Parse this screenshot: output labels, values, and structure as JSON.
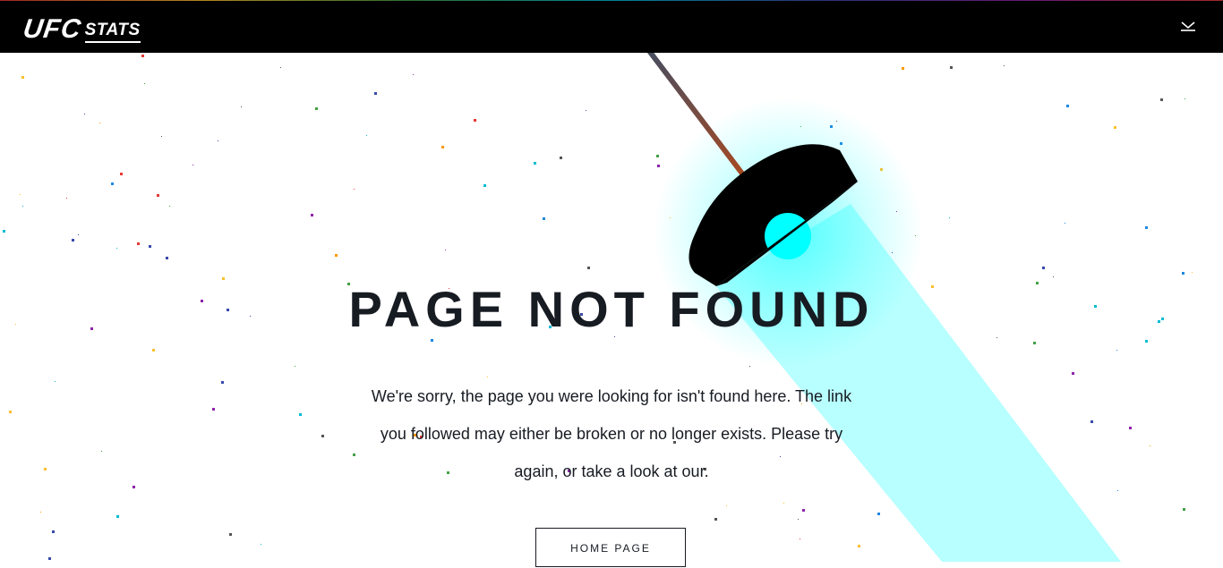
{
  "header": {
    "logo_main": "UFC",
    "logo_sub": "STATS",
    "menu_icon": "chevron-down-icon"
  },
  "error": {
    "title": "PAGE NOT FOUND",
    "message": "We're sorry, the page you were looking for isn't found here. The link you followed may either be broken or no longer exists. Please try again, or take a look at our.",
    "home_button": "HOME PAGE"
  },
  "colors": {
    "header_bg": "#000000",
    "page_bg": "#ffffff",
    "text": "#171b22",
    "lamp_light": "#00ffff",
    "lamp_shade": "#000000"
  },
  "decorations": {
    "lamp_icon": "hanging-lamp-icon",
    "confetti": "confetti-particles"
  }
}
